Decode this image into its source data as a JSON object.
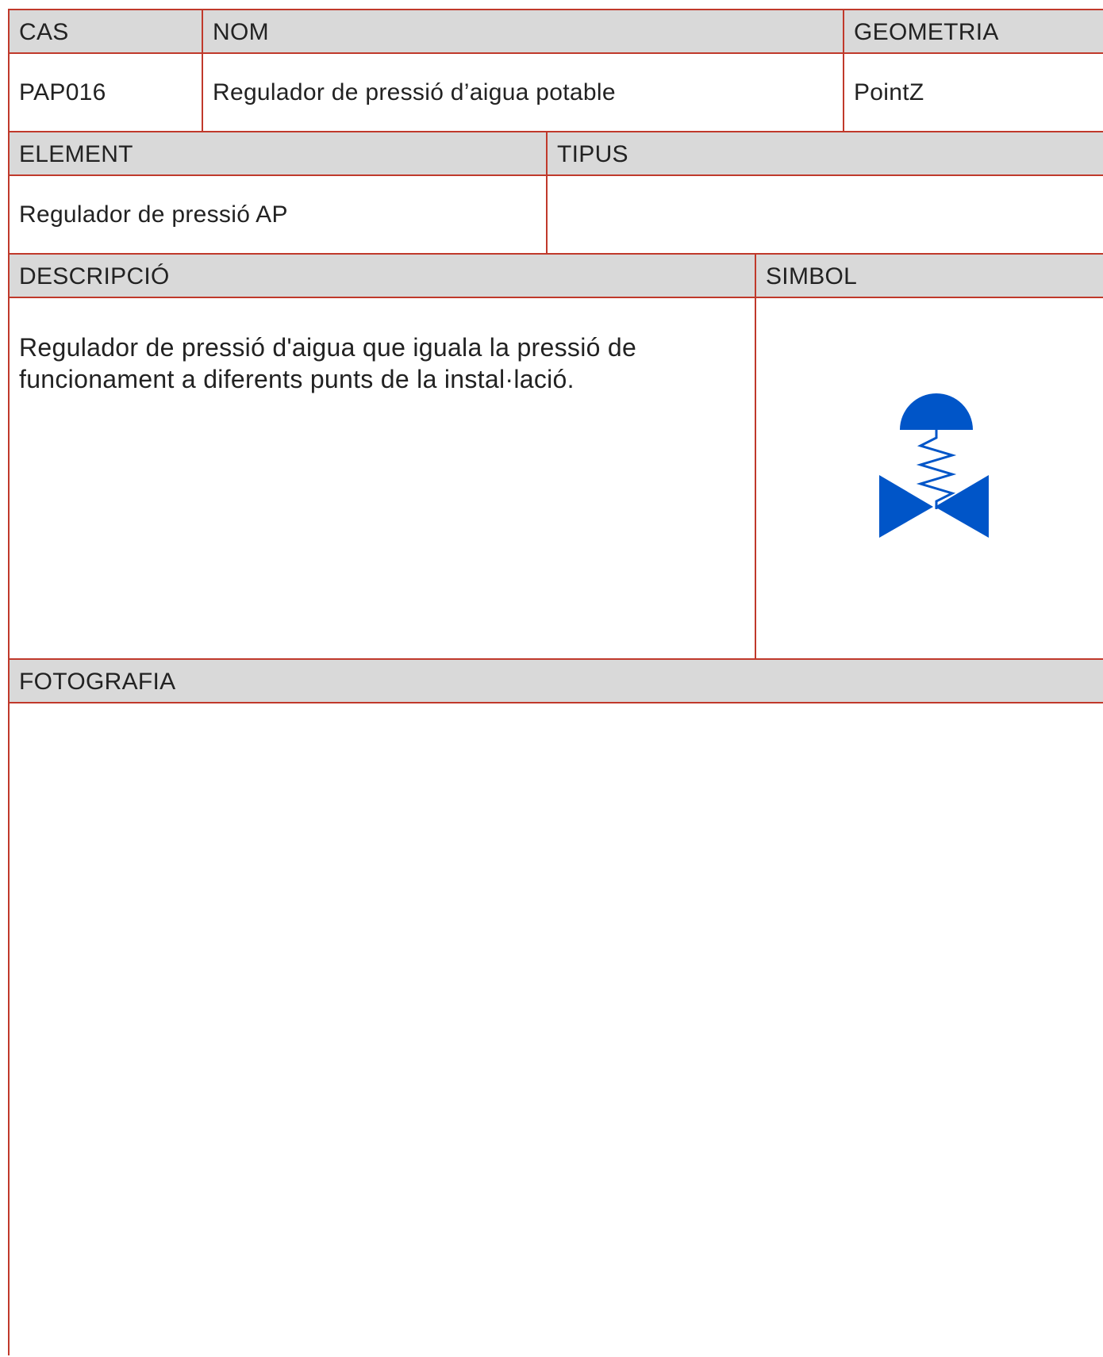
{
  "row1": {
    "cas_header": "CAS",
    "nom_header": "NOM",
    "geometria_header": "GEOMETRIA",
    "cas_value": "PAP016",
    "nom_value": "Regulador de pressió d’aigua potable",
    "geometria_value": "PointZ"
  },
  "row2": {
    "element_header": "ELEMENT",
    "tipus_header": "TIPUS",
    "element_value": "Regulador de pressió AP",
    "tipus_value": ""
  },
  "row3": {
    "descripcio_header": "DESCRIPCIÓ",
    "simbol_header": "SIMBOL",
    "descripcio_value": "Regulador de pressió d'aigua que iguala la pressió de funcionament a diferents punts de la instal·lació.",
    "symbol_icon": "pressure-regulator-valve-icon",
    "symbol_color": "#0055c8"
  },
  "row4": {
    "fotografia_header": "FOTOGRAFIA"
  },
  "colors": {
    "border": "#c0392b",
    "header_bg": "#d9d9d9"
  }
}
